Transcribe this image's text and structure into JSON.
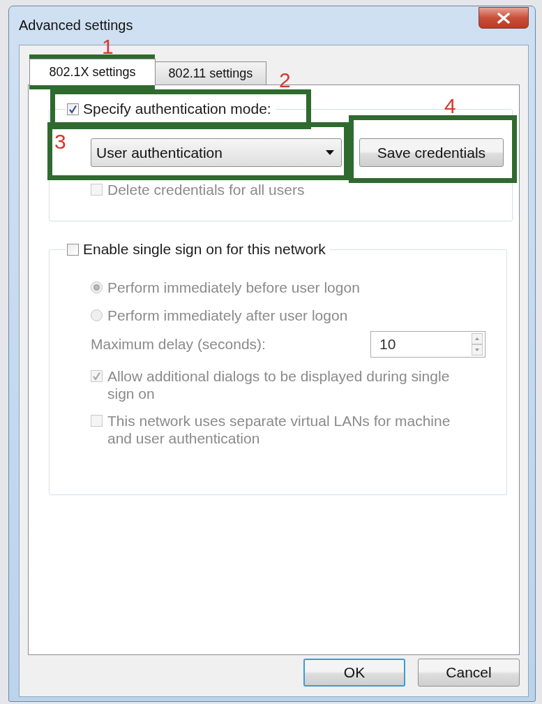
{
  "window": {
    "title": "Advanced settings"
  },
  "tabs": [
    {
      "label": "802.1X settings",
      "selected": true
    },
    {
      "label": "802.11 settings",
      "selected": false
    }
  ],
  "auth_group": {
    "checkbox": {
      "label": "Specify authentication mode:",
      "checked": true
    },
    "mode_dropdown": {
      "value": "User authentication"
    },
    "save_button": "Save credentials",
    "delete_checkbox": {
      "label": "Delete credentials for all users",
      "checked": false,
      "disabled": true
    }
  },
  "sso_group": {
    "checkbox": {
      "label": "Enable single sign on for this network",
      "checked": false
    },
    "radios": [
      {
        "label": "Perform immediately before user logon",
        "selected": true,
        "disabled": true
      },
      {
        "label": "Perform immediately after user logon",
        "selected": false,
        "disabled": true
      }
    ],
    "delay": {
      "label": "Maximum delay (seconds):",
      "value": "10",
      "disabled": true
    },
    "options": [
      {
        "label": "Allow additional dialogs to be displayed during single sign on",
        "checked": true,
        "disabled": true
      },
      {
        "label": "This network uses separate virtual LANs for machine and user authentication",
        "checked": false,
        "disabled": true
      }
    ]
  },
  "buttons": [
    {
      "label": "OK",
      "default": true
    },
    {
      "label": "Cancel",
      "default": false
    }
  ],
  "annotations": [
    {
      "number": "1"
    },
    {
      "number": "2"
    },
    {
      "number": "3"
    },
    {
      "number": "4"
    }
  ]
}
